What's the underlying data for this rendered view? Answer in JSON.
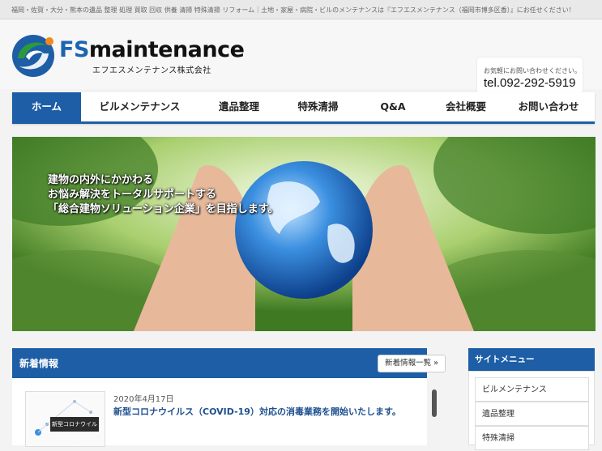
{
  "topbar": {
    "text": "福岡・佐賀・大分・熊本の遺品 整理 処理 買取 回収 供養 清掃 特殊清掃 リフォーム｜土地・家屋・病院・ビルのメンテナンスは『エフエスメンテナンス（福岡市博多区香）』にお任せください！"
  },
  "header": {
    "logo_prefix": "FS",
    "logo_main": "maintenance",
    "logo_sub": "エフエスメンテナンス株式会社",
    "contact_label": "お気軽にお問い合わせください。",
    "phone": "tel.092-292-5919"
  },
  "nav": {
    "items": [
      {
        "label": "ホーム"
      },
      {
        "label": "ビルメンテナンス"
      },
      {
        "label": "遺品整理"
      },
      {
        "label": "特殊清掃"
      },
      {
        "label": "Q&A"
      },
      {
        "label": "会社概要"
      },
      {
        "label": "お問い合わせ"
      }
    ]
  },
  "hero": {
    "line1": "建物の内外にかかわる",
    "line2": "お悩み解決をトータルサポートする",
    "line3": "「総合建物ソリューション企業」を目指します。"
  },
  "news": {
    "title": "新着情報",
    "more": "新着情報一覧 »",
    "thumb_label": "新型コロナウイルス",
    "date": "2020年4月17日",
    "headline": "新型コロナウイルス（COVID-19）対応の消毒業務を開始いたします。"
  },
  "sidebar": {
    "title": "サイトメニュー",
    "items": [
      {
        "label": "ビルメンテナンス"
      },
      {
        "label": "遺品整理"
      },
      {
        "label": "特殊清掃"
      }
    ]
  },
  "colors": {
    "brand": "#1d5ea6",
    "logo_green": "#2a9a3c",
    "logo_orange": "#f08a1c"
  }
}
